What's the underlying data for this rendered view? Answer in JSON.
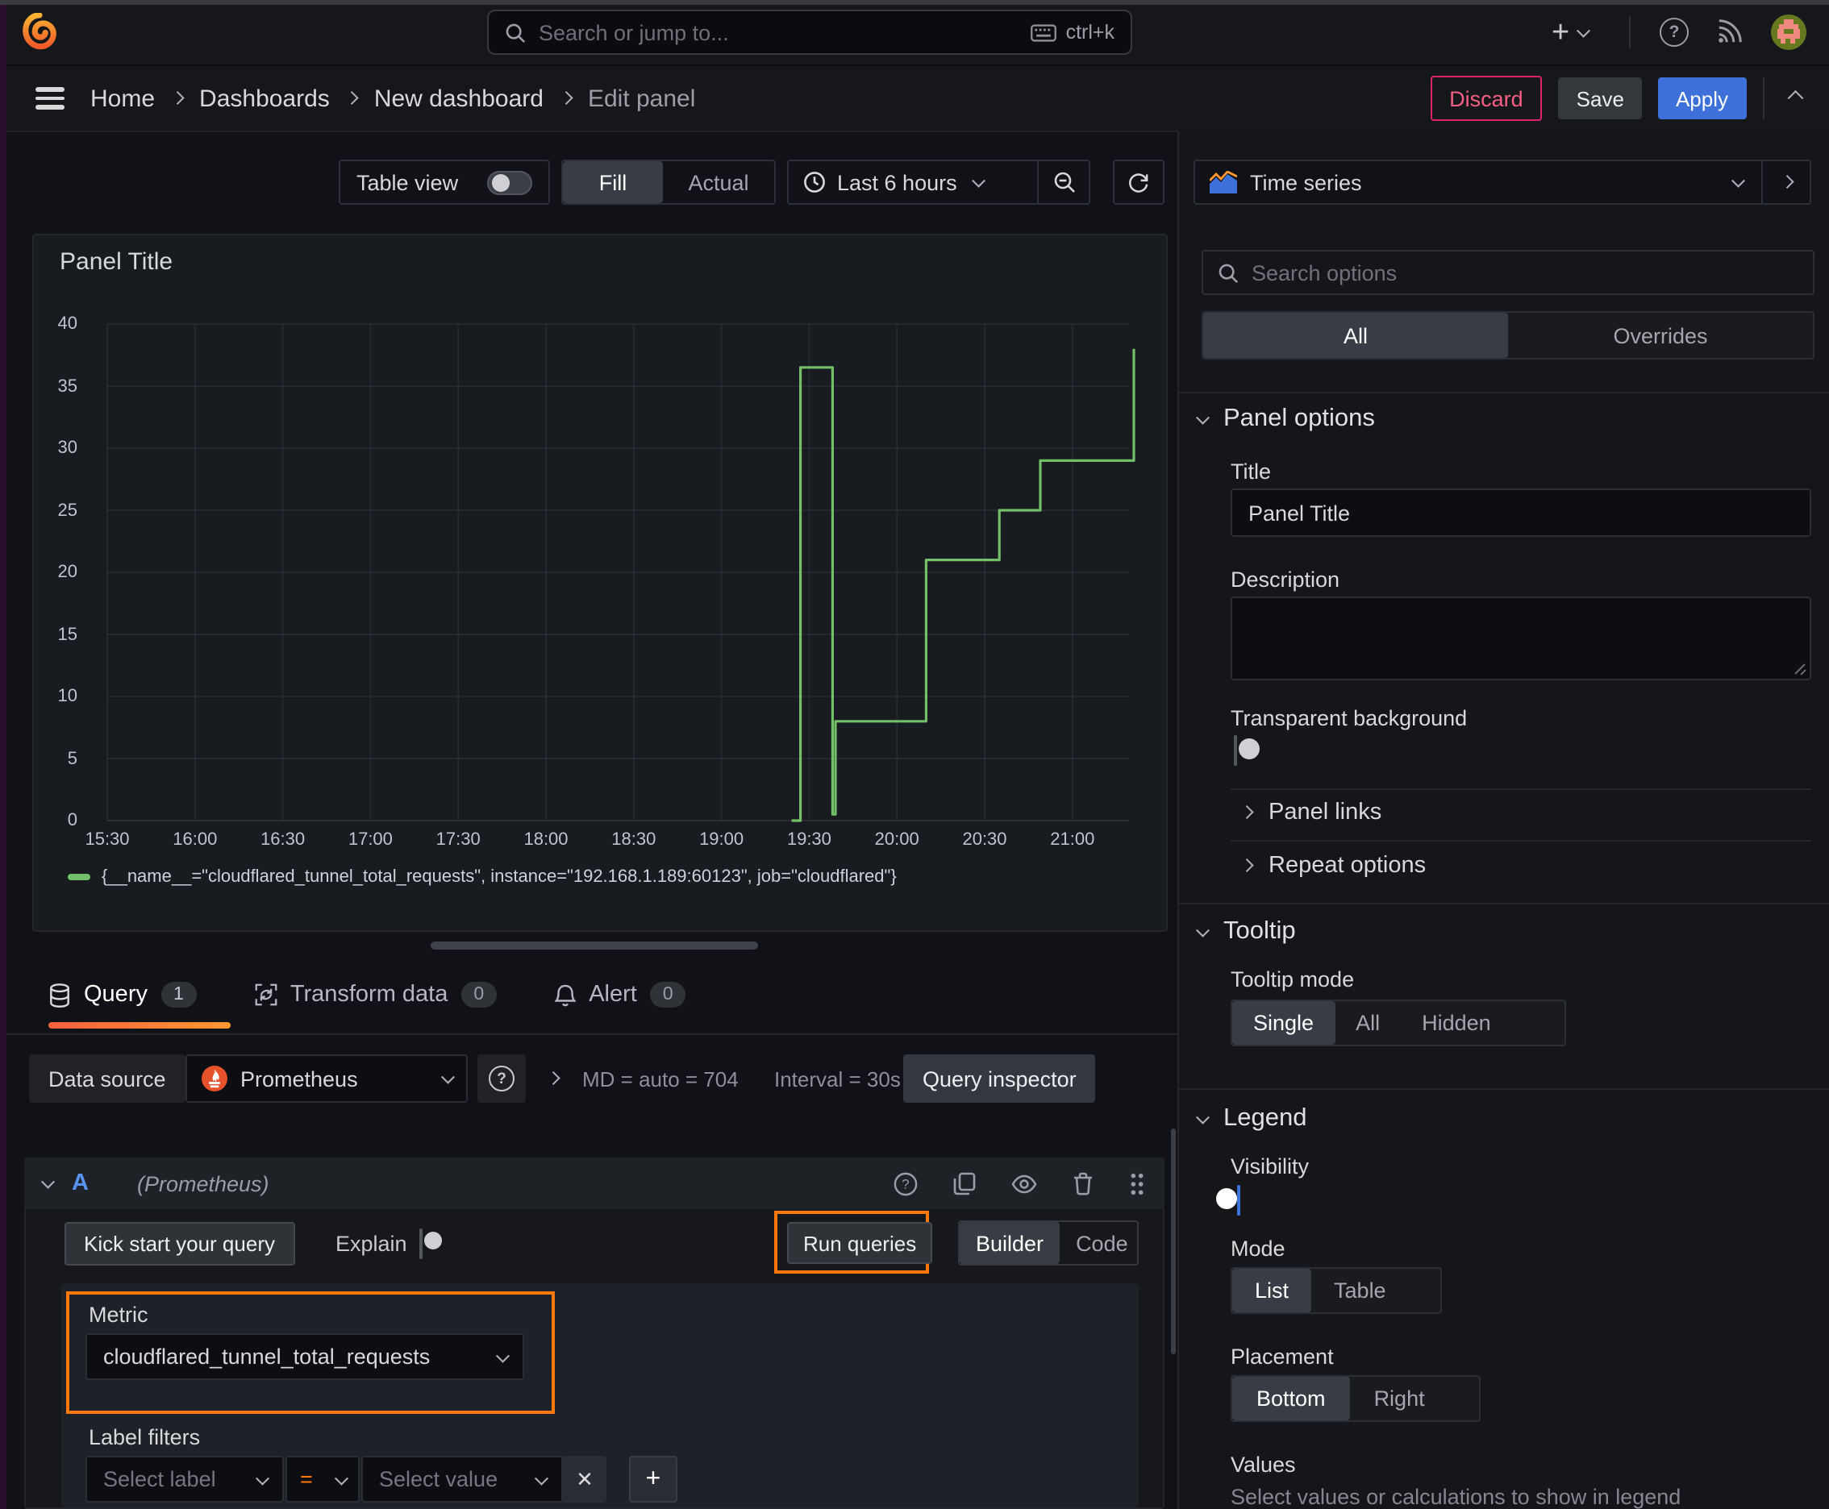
{
  "topbar": {
    "search_placeholder": "Search or jump to...",
    "search_shortcut": "ctrl+k"
  },
  "breadcrumbs": {
    "items": [
      "Home",
      "Dashboards",
      "New dashboard"
    ],
    "current": "Edit panel"
  },
  "actions": {
    "discard": "Discard",
    "save": "Save",
    "apply": "Apply"
  },
  "panel_toolbar": {
    "table_view_label": "Table view",
    "fill_label": "Fill",
    "actual_label": "Actual",
    "time_range_label": "Last 6 hours"
  },
  "panel": {
    "title": "Panel Title"
  },
  "chart_data": {
    "type": "line",
    "line_style": "step-after",
    "title": "Panel Title",
    "x_ticks": [
      "15:30",
      "16:00",
      "16:30",
      "17:00",
      "17:30",
      "18:00",
      "18:30",
      "19:00",
      "19:30",
      "20:00",
      "20:30",
      "21:00"
    ],
    "y_ticks": [
      0,
      5,
      10,
      15,
      20,
      25,
      30,
      35,
      40
    ],
    "ylim": [
      0,
      40
    ],
    "grid": true,
    "legend_position": "bottom",
    "series": [
      {
        "name": "{__name__=\"cloudflared_tunnel_total_requests\", instance=\"192.168.1.189:60123\", job=\"cloudflared\"}",
        "color": "#73bf69",
        "points": [
          [
            "19:24",
            0
          ],
          [
            "19:27",
            36.5
          ],
          [
            "19:38",
            0.5
          ],
          [
            "19:39",
            8
          ],
          [
            "20:10",
            21
          ],
          [
            "20:35",
            25
          ],
          [
            "20:49",
            29
          ],
          [
            "21:21",
            38
          ]
        ]
      }
    ]
  },
  "tabs": {
    "query": {
      "label": "Query",
      "count": "1"
    },
    "transform": {
      "label": "Transform data",
      "count": "0"
    },
    "alert": {
      "label": "Alert",
      "count": "0"
    }
  },
  "datasource": {
    "label": "Data source",
    "name": "Prometheus",
    "md_stat": "MD = auto = 704",
    "interval_stat": "Interval = 30s",
    "query_inspector": "Query inspector"
  },
  "query_row": {
    "ref_id": "A",
    "datasource_hint": "(Prometheus)"
  },
  "query_toolbar": {
    "kick_start": "Kick start your query",
    "explain": "Explain",
    "run_queries": "Run queries",
    "builder": "Builder",
    "code": "Code"
  },
  "builder": {
    "metric_label": "Metric",
    "metric_value": "cloudflared_tunnel_total_requests",
    "label_filters_label": "Label filters",
    "select_label_placeholder": "Select label",
    "operator": "=",
    "select_value_placeholder": "Select value"
  },
  "options_pane": {
    "visualization": "Time series",
    "search_placeholder": "Search options",
    "tabs": {
      "all": "All",
      "overrides": "Overrides"
    },
    "panel_options": {
      "heading": "Panel options",
      "title_label": "Title",
      "title_value": "Panel Title",
      "description_label": "Description",
      "transparent_label": "Transparent background",
      "panel_links": "Panel links",
      "repeat_options": "Repeat options"
    },
    "tooltip": {
      "heading": "Tooltip",
      "mode_label": "Tooltip mode",
      "modes": [
        "Single",
        "All",
        "Hidden"
      ],
      "selected_mode": "Single"
    },
    "legend": {
      "heading": "Legend",
      "visibility_label": "Visibility",
      "mode_label": "Mode",
      "modes": [
        "List",
        "Table"
      ],
      "selected_mode": "List",
      "placement_label": "Placement",
      "placements": [
        "Bottom",
        "Right"
      ],
      "selected_placement": "Bottom",
      "values_label": "Values",
      "values_help": "Select values or calculations to show in legend"
    }
  },
  "colors": {
    "accent_blue": "#3d71d9",
    "series_green": "#73bf69",
    "annotation_orange": "#ff780a",
    "destructive_pink": "#e0226e",
    "ref_id_blue": "#5794f2"
  }
}
